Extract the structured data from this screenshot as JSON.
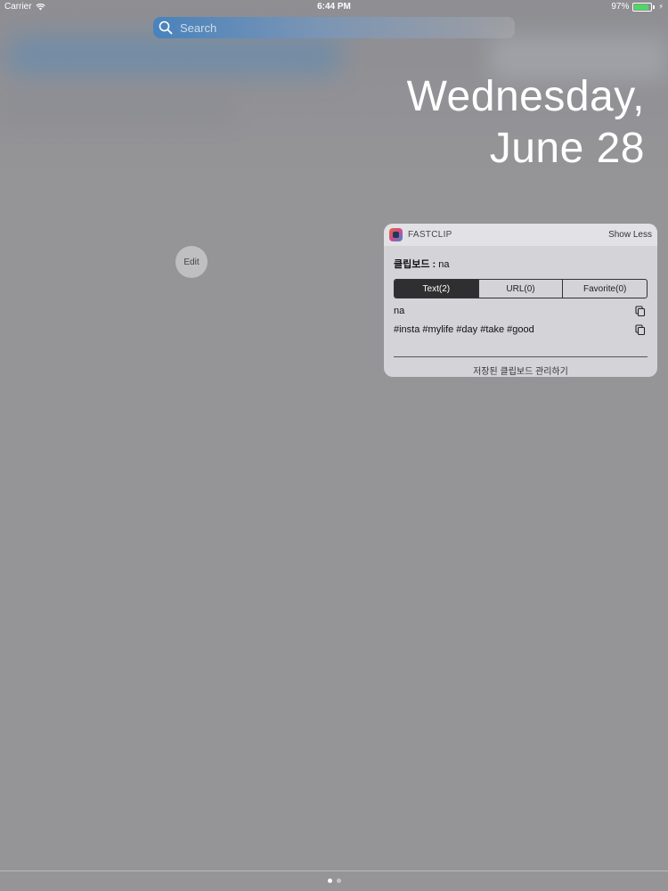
{
  "status_bar": {
    "carrier": "Carrier",
    "time": "6:44 PM",
    "battery_percent": "97%",
    "battery_level": 0.97,
    "battery_color": "#4cd964"
  },
  "search": {
    "placeholder": "Search",
    "icon": "search-icon"
  },
  "date": {
    "weekday": "Wednesday,",
    "date": "June 28"
  },
  "edit": {
    "label": "Edit"
  },
  "widget": {
    "app_name": "FASTCLIP",
    "show_less": "Show Less",
    "clipboard_label": "클립보드 :",
    "clipboard_value": "na",
    "tabs": [
      {
        "label": "Text(2)",
        "active": true
      },
      {
        "label": "URL(0)",
        "active": false
      },
      {
        "label": "Favorite(0)",
        "active": false
      }
    ],
    "items": [
      {
        "text": "na",
        "icon": "copy-icon"
      },
      {
        "text": "#insta #mylife #day #take #good",
        "icon": "copy-icon"
      }
    ],
    "manage_link": "저장된 클립보드 관리하기",
    "active_tab_color": "#2f2f31"
  },
  "pages": {
    "count": 2,
    "current": 1
  }
}
